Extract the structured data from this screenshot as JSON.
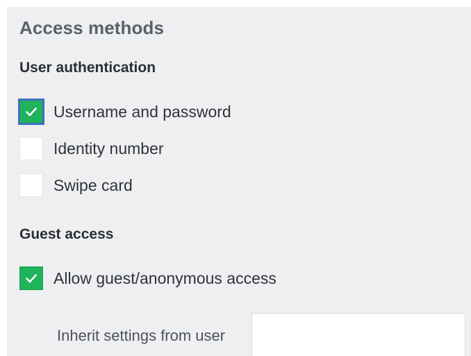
{
  "section": {
    "title": "Access methods"
  },
  "user_authentication": {
    "heading": "User authentication",
    "options": [
      {
        "label": "Username and password",
        "checked": true
      },
      {
        "label": "Identity number",
        "checked": false
      },
      {
        "label": "Swipe card",
        "checked": false
      }
    ]
  },
  "guest_access": {
    "heading": "Guest access",
    "allow_label": "Allow guest/anonymous access",
    "allow_checked": true,
    "inherit_label": "Inherit settings from user",
    "inherit_value": "",
    "inherit_placeholder": ""
  },
  "colors": {
    "panel_background": "#eeeff1",
    "checkbox_checked": "#1fb35a",
    "focus_ring": "#3f6fc2"
  },
  "icons": {
    "checked_mark": "checkmark-icon"
  }
}
